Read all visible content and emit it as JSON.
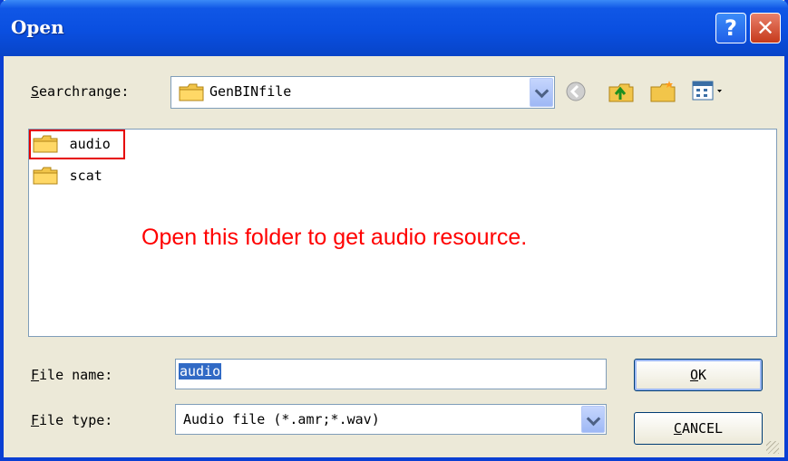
{
  "window": {
    "title": "Open",
    "help_label": "?",
    "close_label": "✕"
  },
  "search": {
    "label_underlined": "S",
    "label_rest": "earchrange:",
    "folder": "GenBINfile"
  },
  "toolbar": {
    "icons": [
      "back-icon",
      "up-folder-icon",
      "new-folder-icon",
      "view-menu-icon"
    ]
  },
  "files": [
    {
      "name": "audio",
      "type": "folder",
      "highlighted": true
    },
    {
      "name": "scat",
      "type": "folder",
      "highlighted": false
    }
  ],
  "annotation": "Open this folder to get audio resource.",
  "filename": {
    "label_underlined": "F",
    "label_rest": "ile name:",
    "value": "audio"
  },
  "filetype": {
    "label_underlined": "F",
    "label_rest": "ile type:",
    "value": "Audio file (*.amr;*.wav)"
  },
  "buttons": {
    "ok_underlined": "O",
    "ok_rest": "K",
    "cancel_underlined": "C",
    "cancel_rest": "ANCEL"
  },
  "colors": {
    "titlebar": "#0a4fe0",
    "annotation": "#ff0000",
    "highlight_box": "#e60000",
    "selection": "#316ac5"
  }
}
